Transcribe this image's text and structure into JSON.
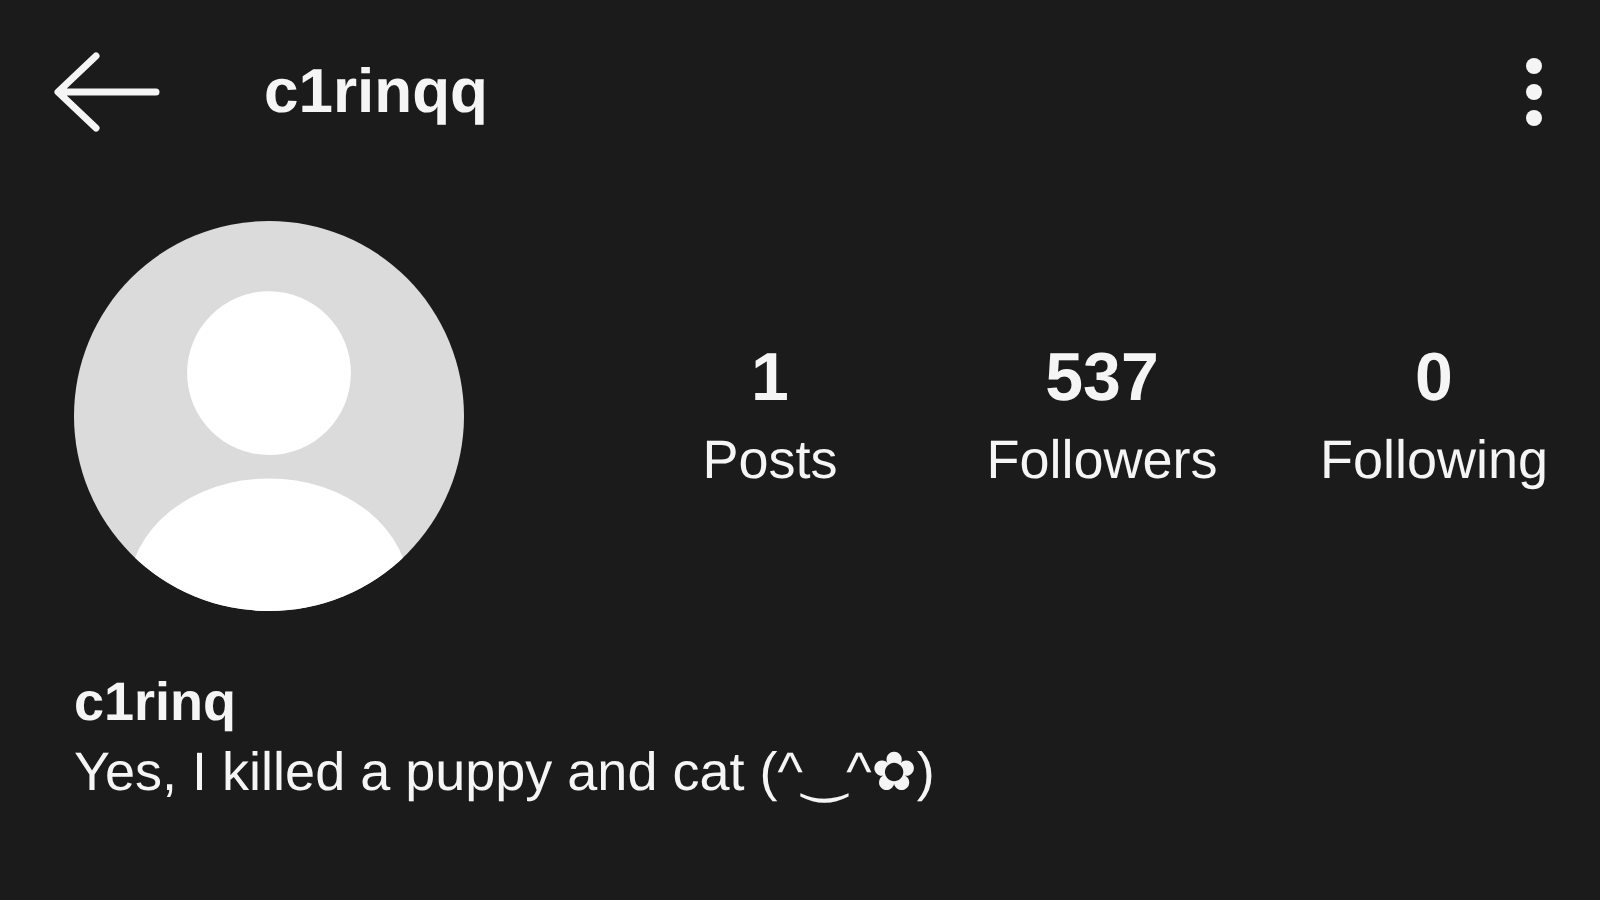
{
  "header": {
    "username": "c1rinqq"
  },
  "stats": [
    {
      "value": "1",
      "label": "Posts"
    },
    {
      "value": "537",
      "label": "Followers"
    },
    {
      "value": "0",
      "label": "Following"
    }
  ],
  "profile": {
    "name": "c1rinq",
    "bio": "Yes, I killed a puppy and cat (^‿^✿)"
  }
}
